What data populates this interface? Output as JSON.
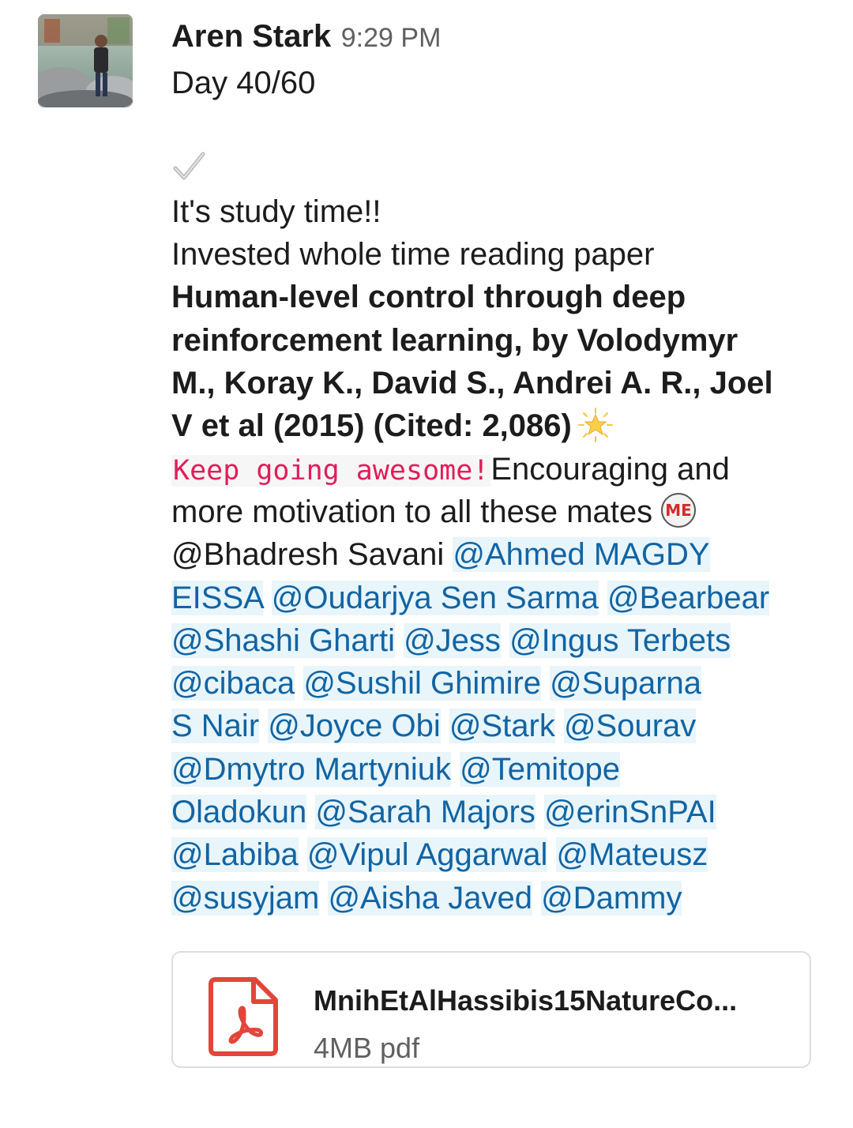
{
  "message": {
    "sender": "Aren Stark",
    "timestamp": "9:29 PM",
    "avatar_icon": "user-avatar-photo",
    "day": "Day 40/60",
    "check_emoji": "heavy-check-mark-emoji",
    "study_line": "It's study time!!",
    "invested_line": "Invested whole time reading paper",
    "paper_lines": [
      "Human-level control through deep",
      "reinforcement learning, by Volodymyr",
      "M., Koray K., David S., Andrei A. R., Joel",
      "V et al (2015) (Cited: 2,086)"
    ],
    "star_emoji": "glowing-star-emoji",
    "code_text": "Keep going awesome!",
    "encourage_text": "Encouraging and",
    "motivation_line": "more motivation to all these mates",
    "me_emoji": "me-badge-emoji",
    "mentions": {
      "bhadresh": "@Bhadresh Savani",
      "ahmed_1": "@Ahmed MAGDY",
      "ahmed_2": "EISSA",
      "oudarjya": "@Oudarjya Sen Sarma",
      "bearbear": "@Bearbear",
      "shashi": "@Shashi Gharti",
      "jess": "@Jess",
      "ingus": "@Ingus Terbets",
      "cibaca": "@cibaca",
      "sushil": "@Sushil Ghimire",
      "suparna_1": "@Suparna",
      "suparna_2": "S Nair",
      "joyce": "@Joyce Obi",
      "stark": "@Stark",
      "sourav": "@Sourav",
      "dmytro": "@Dmytro Martyniuk",
      "temitope_1": "@Temitope",
      "temitope_2": "Oladokun",
      "sarah": "@Sarah Majors",
      "erin": "@erinSnPAI",
      "labiba": "@Labiba",
      "vipul": "@Vipul Aggarwal",
      "mateusz": "@Mateusz",
      "susyjam": "@susyjam",
      "aisha": "@Aisha Javed",
      "dammy": "@Dammy"
    }
  },
  "attachment": {
    "icon": "pdf-file-icon",
    "file_name": "MnihEtAlHassibis15NatureCo...",
    "meta": "4MB pdf"
  },
  "colors": {
    "mention_text": "#1264a3",
    "mention_bg": "#e8f5fa",
    "code_text": "#e01e5a",
    "pdf_red": "#e2463b",
    "meta_gray": "#616061"
  }
}
